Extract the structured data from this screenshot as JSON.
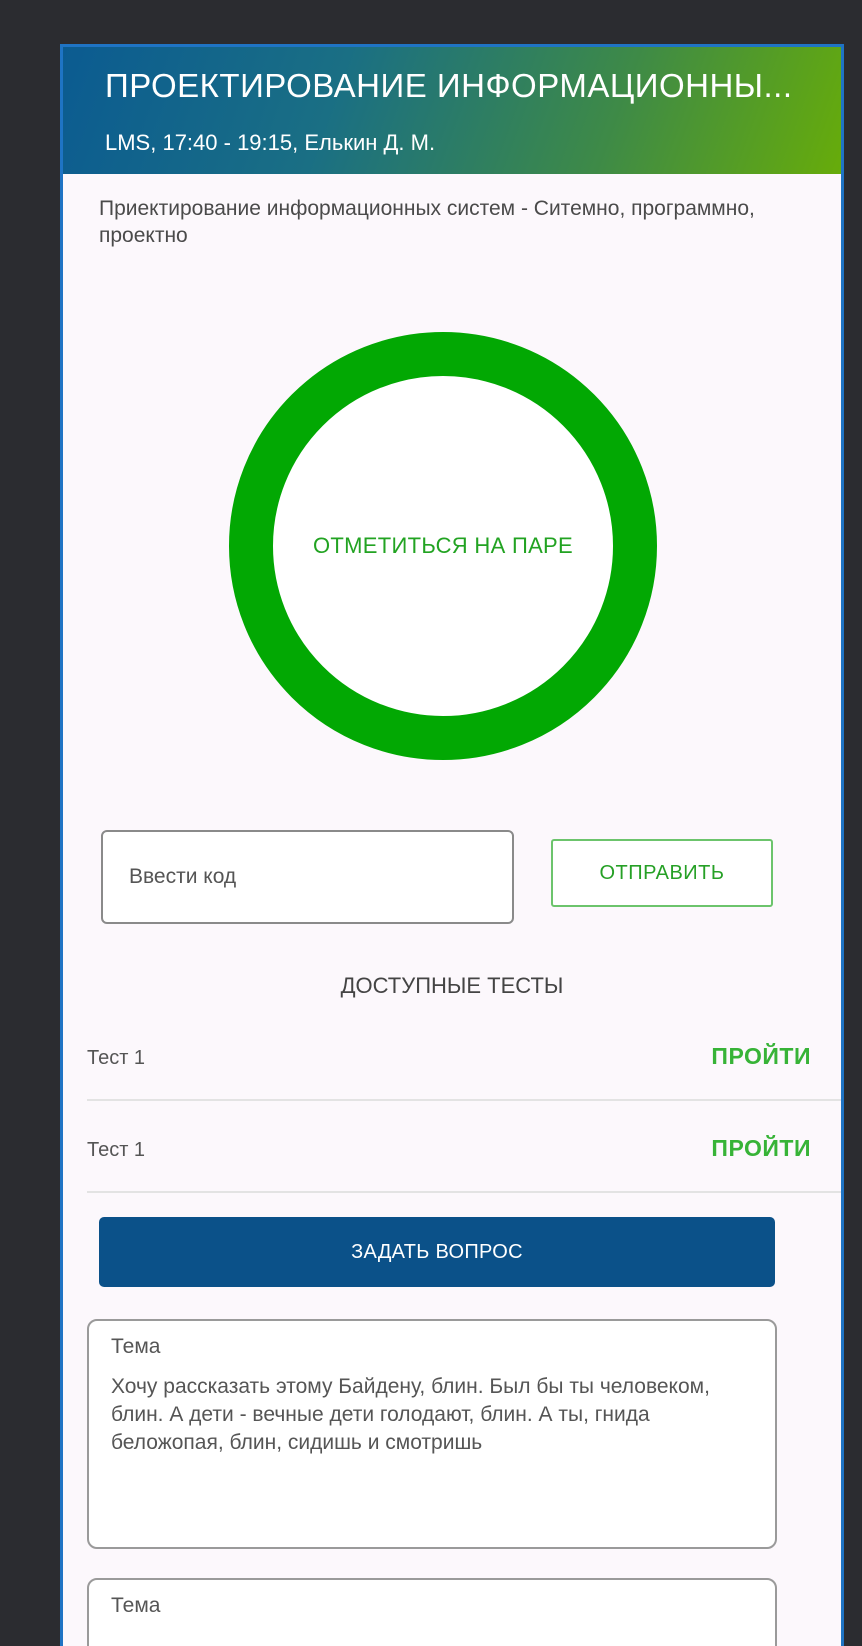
{
  "header": {
    "title": "ПРОЕКТИРОВАНИЕ ИНФОРМАЦИОННЫ...",
    "subtitle": "LMS, 17:40 - 19:15, Елькин Д. М."
  },
  "description": "Приектирование информационных систем - Ситемно, программно, проектно",
  "attendance": {
    "label": "ОТМЕТИТЬСЯ НА ПАРЕ",
    "ring_color": "#02a803"
  },
  "code": {
    "placeholder": "Ввести код",
    "submit_label": "ОТПРАВИТЬ"
  },
  "tests": {
    "heading": "ДОСТУПНЫЕ ТЕСТЫ",
    "items": [
      {
        "name": "Тест 1",
        "action": "ПРОЙТИ"
      },
      {
        "name": "Тест 1",
        "action": "ПРОЙТИ"
      }
    ]
  },
  "ask_button": "ЗАДАТЬ ВОПРОС",
  "questions": [
    {
      "topic": "Тема",
      "text": "Хочу рассказать этому Байдену, блин. Был бы ты человеком, блин. А дети - вечные дети голодают, блин. А ты, гнида беложопая, блин, сидишь и смотришь"
    },
    {
      "topic": "Тема",
      "text": ""
    }
  ],
  "colors": {
    "accent_blue": "#0b5189",
    "accent_green": "#37b337",
    "frame_blue": "#1f74c4"
  }
}
